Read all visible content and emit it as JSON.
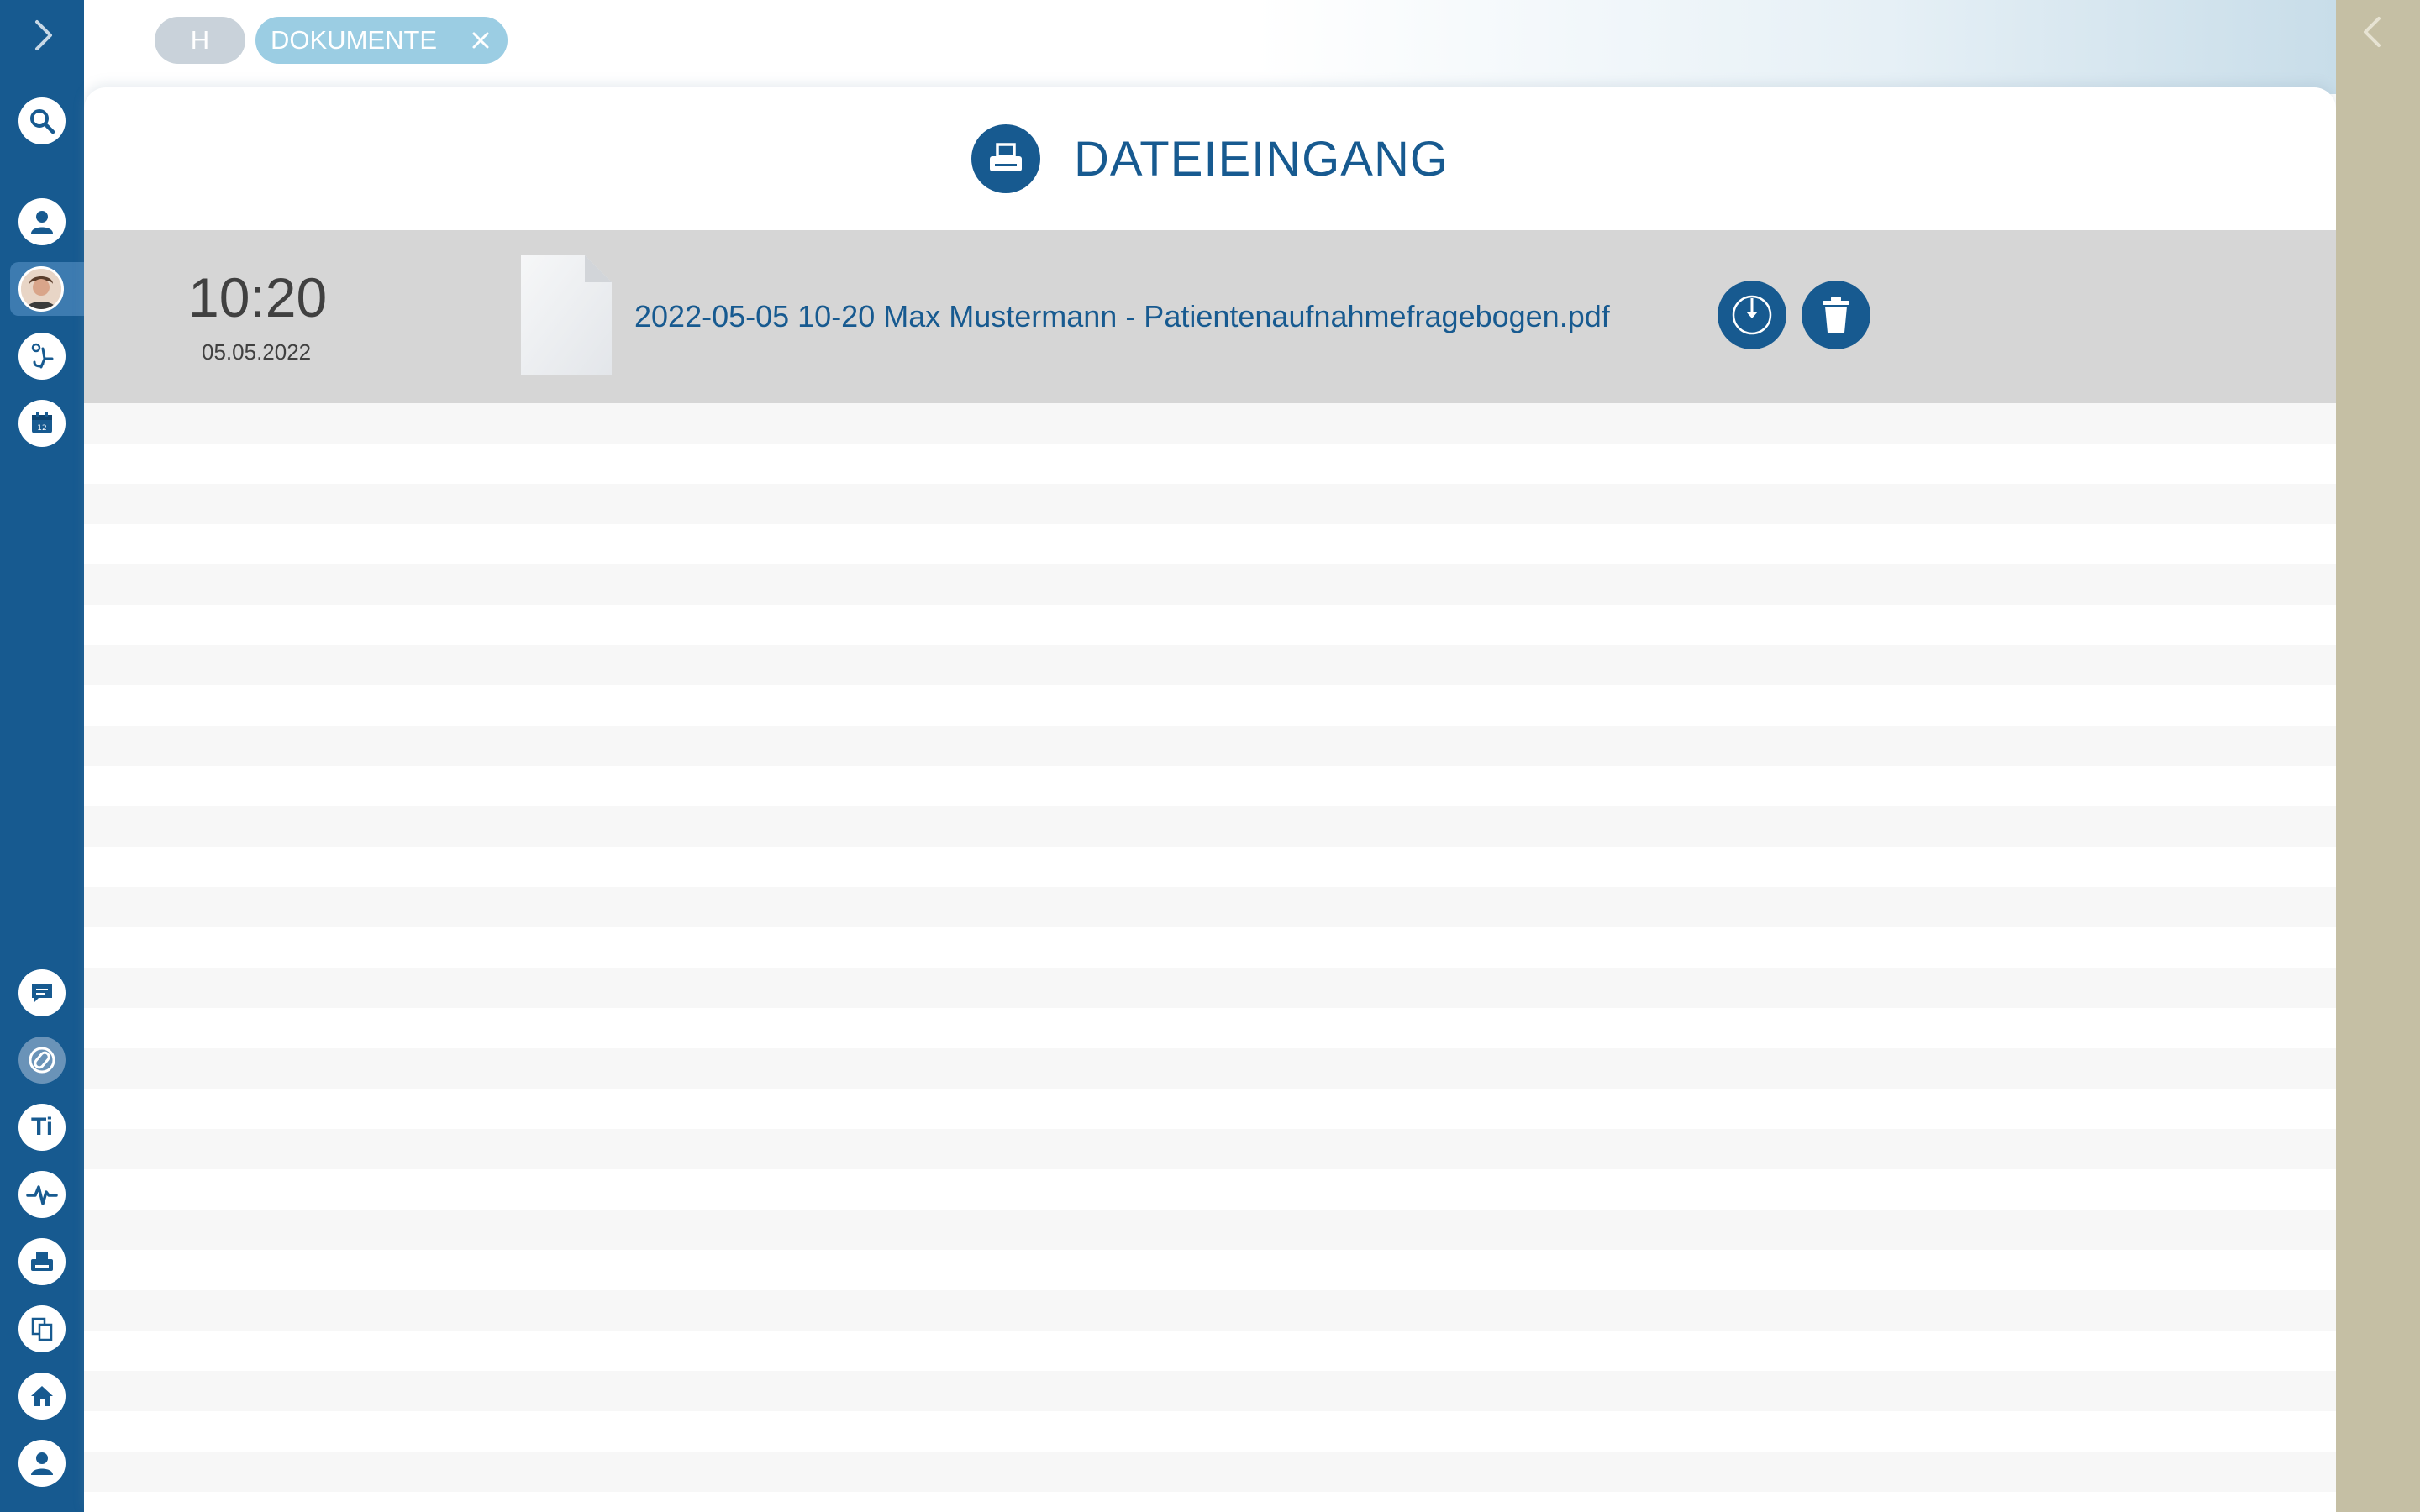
{
  "breadcrumbs": {
    "home_label": "H",
    "current_label": "DOKUMENTE"
  },
  "page": {
    "title": "DATEIEINGANG",
    "title_icon": "printer-icon"
  },
  "files": [
    {
      "time": "10:20",
      "date": "05.05.2022",
      "name": "2022-05-05 10-20 Max Mustermann - Patientenaufnahmefragebogen.pdf",
      "actions": [
        "download-icon",
        "trash-icon"
      ]
    }
  ],
  "sidebar": {
    "top_icons": [
      "search-icon",
      "person-icon",
      "avatar",
      "patient-chair-icon",
      "calendar-icon"
    ],
    "bottom_icons": [
      "chat-icon",
      "pill-icon",
      "ti-icon",
      "heartbeat-icon",
      "printer-icon",
      "copy-icon",
      "house-icon",
      "user-icon"
    ],
    "ti_label": "Ti"
  },
  "colors": {
    "primary": "#175a90",
    "sidebar": "#175a90",
    "right_panel": "#c5bfa4",
    "row_highlight": "#d6d6d6",
    "chip_current": "#9bcde3",
    "chip_home": "#c9d2da"
  }
}
